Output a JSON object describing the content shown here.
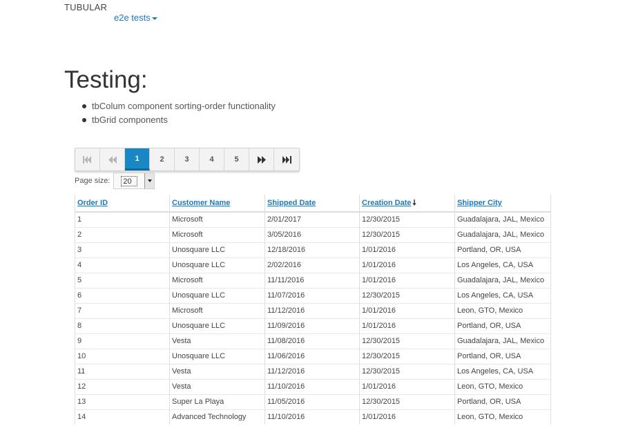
{
  "nav": {
    "brand": "TUBULAR",
    "menu_label": "e2e tests"
  },
  "page": {
    "title": "Testing:",
    "items": [
      "tbColum component sorting-order functionality",
      "tbGrid components"
    ]
  },
  "pager": {
    "first_icon": "first-page-icon",
    "prev_icon": "previous-page-icon",
    "next_icon": "next-page-icon",
    "last_icon": "last-page-icon",
    "pages": [
      "1",
      "2",
      "3",
      "4",
      "5"
    ],
    "active_page": "1"
  },
  "page_size": {
    "label": "Page size:",
    "value": "20"
  },
  "grid": {
    "columns": [
      "Order ID",
      "Customer Name",
      "Shipped Date",
      "Creation Date",
      "Shipper City"
    ],
    "sorted_column": "Creation Date",
    "sort_direction": "descending",
    "rows": [
      [
        "1",
        "Microsoft",
        "2/01/2017",
        "12/30/2015",
        "Guadalajara, JAL, Mexico"
      ],
      [
        "2",
        "Microsoft",
        "3/05/2016",
        "12/30/2015",
        "Guadalajara, JAL, Mexico"
      ],
      [
        "3",
        "Unosquare LLC",
        "12/18/2016",
        "1/01/2016",
        "Portland, OR, USA"
      ],
      [
        "4",
        "Unosquare LLC",
        "2/02/2016",
        "1/01/2016",
        "Los Angeles, CA, USA"
      ],
      [
        "5",
        "Microsoft",
        "11/11/2016",
        "1/01/2016",
        "Guadalajara, JAL, Mexico"
      ],
      [
        "6",
        "Unosquare LLC",
        "11/07/2016",
        "12/30/2015",
        "Los Angeles, CA, USA"
      ],
      [
        "7",
        "Microsoft",
        "11/12/2016",
        "1/01/2016",
        "Leon, GTO, Mexico"
      ],
      [
        "8",
        "Unosquare LLC",
        "11/09/2016",
        "1/01/2016",
        "Portland, OR, USA"
      ],
      [
        "9",
        "Vesta",
        "11/08/2016",
        "12/30/2015",
        "Guadalajara, JAL, Mexico"
      ],
      [
        "10",
        "Unosquare LLC",
        "11/06/2016",
        "12/30/2015",
        "Portland, OR, USA"
      ],
      [
        "11",
        "Vesta",
        "11/12/2016",
        "12/30/2015",
        "Los Angeles, CA, USA"
      ],
      [
        "12",
        "Vesta",
        "11/10/2016",
        "1/01/2016",
        "Leon, GTO, Mexico"
      ],
      [
        "13",
        "Super La Playa",
        "11/05/2016",
        "12/30/2015",
        "Portland, OR, USA"
      ],
      [
        "14",
        "Advanced Technology",
        "11/10/2016",
        "1/01/2016",
        "Leon, GTO, Mexico"
      ]
    ]
  },
  "colors": {
    "accent": "#1887c4",
    "link": "#1a7abf"
  }
}
